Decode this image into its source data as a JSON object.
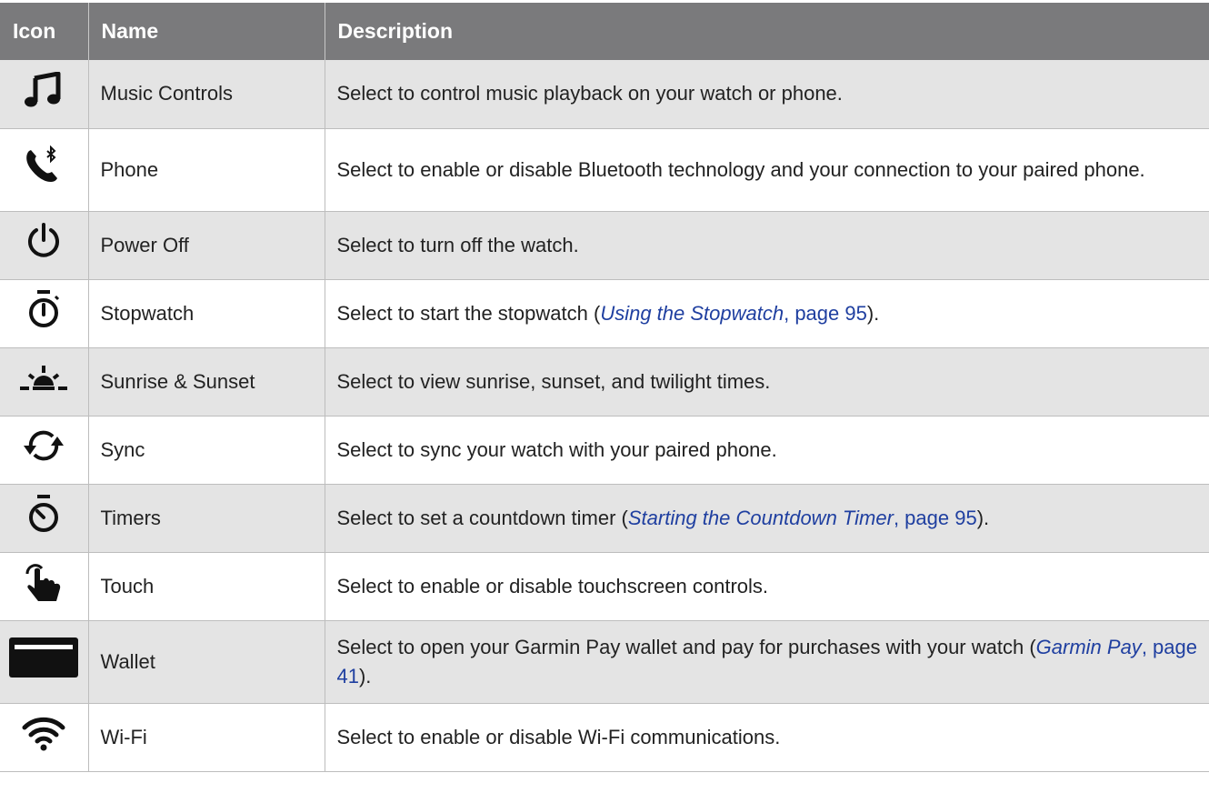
{
  "table": {
    "headers": {
      "icon": "Icon",
      "name": "Name",
      "description": "Description"
    },
    "rows": [
      {
        "icon": "music-note-icon",
        "name": "Music Controls",
        "description": "Select to control music playback on your watch or phone."
      },
      {
        "icon": "phone-bluetooth-icon",
        "name": "Phone",
        "description": "Select to enable or disable Bluetooth technology and your connection to your paired phone."
      },
      {
        "icon": "power-icon",
        "name": "Power Off",
        "description": "Select to turn off the watch."
      },
      {
        "icon": "stopwatch-icon",
        "name": "Stopwatch",
        "description_pre": "Select to start the stopwatch (",
        "link_title": "Using the Stopwatch",
        "link_page": ", page 95",
        "description_post": ")."
      },
      {
        "icon": "sunrise-sunset-icon",
        "name": "Sunrise & Sunset",
        "description": "Select to view sunrise, sunset, and twilight times."
      },
      {
        "icon": "sync-icon",
        "name": "Sync",
        "description": "Select to sync your watch with your paired phone."
      },
      {
        "icon": "timer-icon",
        "name": "Timers",
        "description_pre": "Select to set a countdown timer (",
        "link_title": "Starting the Countdown Timer",
        "link_page": ", page 95",
        "description_post": ")."
      },
      {
        "icon": "touch-icon",
        "name": "Touch",
        "description": "Select to enable or disable touchscreen controls."
      },
      {
        "icon": "wallet-icon",
        "name": "Wallet",
        "description_pre": "Select to open your Garmin Pay wallet and pay for purchases with your watch (",
        "link_title": "Garmin Pay",
        "link_page": ", page 41",
        "description_post": ")."
      },
      {
        "icon": "wifi-icon",
        "name": "Wi-Fi",
        "description": "Select to enable or disable Wi-Fi communications."
      }
    ]
  }
}
